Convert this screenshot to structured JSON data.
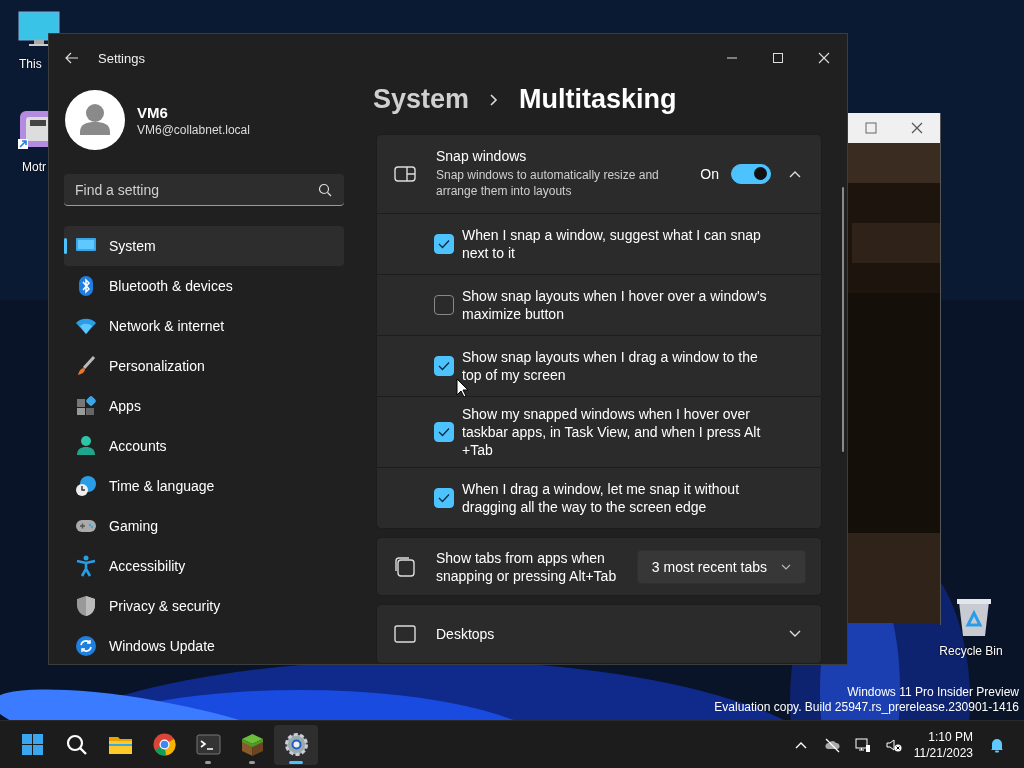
{
  "desktop": {
    "icons": [
      {
        "kind": "monitor",
        "label": "This"
      },
      {
        "kind": "app",
        "label": "Motr"
      },
      {
        "kind": "recycle",
        "label": "Recycle Bin"
      }
    ],
    "build_info": [
      "Windows 11 Pro Insider Preview",
      "Evaluation copy. Build 25947.rs_prerelease.230901-1416"
    ]
  },
  "settings": {
    "title": "Settings",
    "user": {
      "name": "VM6",
      "email": "VM6@collabnet.local"
    },
    "search": {
      "placeholder": "Find a setting"
    },
    "nav": [
      {
        "kind": "system",
        "label": "System",
        "selected": true
      },
      {
        "kind": "bluetooth",
        "label": "Bluetooth & devices",
        "selected": false
      },
      {
        "kind": "network",
        "label": "Network & internet",
        "selected": false
      },
      {
        "kind": "personalization",
        "label": "Personalization",
        "selected": false
      },
      {
        "kind": "apps",
        "label": "Apps",
        "selected": false
      },
      {
        "kind": "accounts",
        "label": "Accounts",
        "selected": false
      },
      {
        "kind": "time",
        "label": "Time & language",
        "selected": false
      },
      {
        "kind": "gaming",
        "label": "Gaming",
        "selected": false
      },
      {
        "kind": "accessibility",
        "label": "Accessibility",
        "selected": false
      },
      {
        "kind": "privacy",
        "label": "Privacy & security",
        "selected": false
      },
      {
        "kind": "update",
        "label": "Windows Update",
        "selected": false
      }
    ],
    "breadcrumb": [
      "System",
      "Multitasking"
    ],
    "snap": {
      "title": "Snap windows",
      "description": "Snap windows to automatically resize and arrange them into layouts",
      "state_label": "On",
      "on": true,
      "expanded": true,
      "options": [
        {
          "label": "When I snap a window, suggest what I can snap next to it",
          "checked": true
        },
        {
          "label": "Show snap layouts when I hover over a window's maximize button",
          "checked": false
        },
        {
          "label": "Show snap layouts when I drag a window to the top of my screen",
          "checked": true
        },
        {
          "label": "Show my snapped windows when I hover over taskbar apps, in Task View, and when I press Alt +Tab",
          "checked": true
        },
        {
          "label": "When I drag a window, let me snap it without dragging all the way to the screen edge",
          "checked": true
        }
      ]
    },
    "tabs_setting": {
      "label": "Show tabs from apps when snapping or pressing Alt+Tab",
      "value": "3 most recent tabs"
    },
    "desktops": {
      "label": "Desktops",
      "expanded": false
    }
  },
  "taskbar": {
    "apps": [
      {
        "kind": "start",
        "running": false,
        "selected": false
      },
      {
        "kind": "search",
        "running": false,
        "selected": false
      },
      {
        "kind": "explorer",
        "running": false,
        "selected": false
      },
      {
        "kind": "browser",
        "running": false,
        "selected": false
      },
      {
        "kind": "terminal",
        "running": true,
        "selected": false
      },
      {
        "kind": "block",
        "running": true,
        "selected": false
      },
      {
        "kind": "settings",
        "running": true,
        "selected": true
      }
    ],
    "tray": [
      {
        "kind": "chevron"
      },
      {
        "kind": "cloud-off"
      },
      {
        "kind": "network"
      },
      {
        "kind": "muted"
      }
    ],
    "time": "1:10 PM",
    "date": "11/21/2023"
  }
}
